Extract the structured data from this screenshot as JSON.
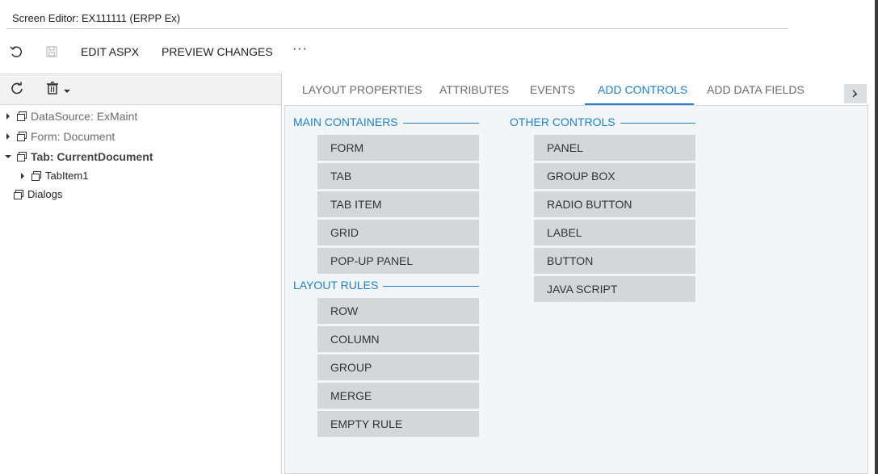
{
  "window": {
    "title": "Screen Editor: EX111111 (ERPP Ex)"
  },
  "toolbar": {
    "undo_icon": "undo-icon",
    "save_icon": "save-icon",
    "edit_aspx_label": "EDIT ASPX",
    "preview_label": "PREVIEW CHANGES",
    "more_label": "···"
  },
  "tree_toolbar": {
    "refresh_icon": "refresh-icon",
    "delete_icon": "trash-icon",
    "dropdown_icon": "caret-down-icon"
  },
  "tree": [
    {
      "label": "DataSource: ExMaint",
      "expanded": false,
      "bold": false
    },
    {
      "label": "Form: Document",
      "expanded": false,
      "bold": false
    },
    {
      "label": "Tab: CurrentDocument",
      "expanded": true,
      "bold": true
    },
    {
      "label": "TabItem1",
      "expanded": false,
      "bold": false
    },
    {
      "label": "Dialogs",
      "expanded": false,
      "bold": false
    }
  ],
  "tabs": [
    {
      "label": "LAYOUT PROPERTIES",
      "active": false
    },
    {
      "label": "ATTRIBUTES",
      "active": false
    },
    {
      "label": "EVENTS",
      "active": false
    },
    {
      "label": "ADD CONTROLS",
      "active": true
    },
    {
      "label": "ADD DATA FIELDS",
      "active": false
    }
  ],
  "sections": {
    "main_containers": {
      "label": "MAIN CONTAINERS",
      "items": [
        "FORM",
        "TAB",
        "TAB ITEM",
        "GRID",
        "POP-UP PANEL"
      ]
    },
    "layout_rules": {
      "label": "LAYOUT RULES",
      "items": [
        "ROW",
        "COLUMN",
        "GROUP",
        "MERGE",
        "EMPTY RULE"
      ]
    },
    "other_controls": {
      "label": "OTHER CONTROLS",
      "items": [
        "PANEL",
        "GROUP BOX",
        "RADIO BUTTON",
        "LABEL",
        "BUTTON",
        "JAVA SCRIPT"
      ]
    }
  },
  "colors": {
    "accent": "#1f7fc7",
    "button_bg": "#d3d7da",
    "panel_bg": "#f2f6f8"
  }
}
